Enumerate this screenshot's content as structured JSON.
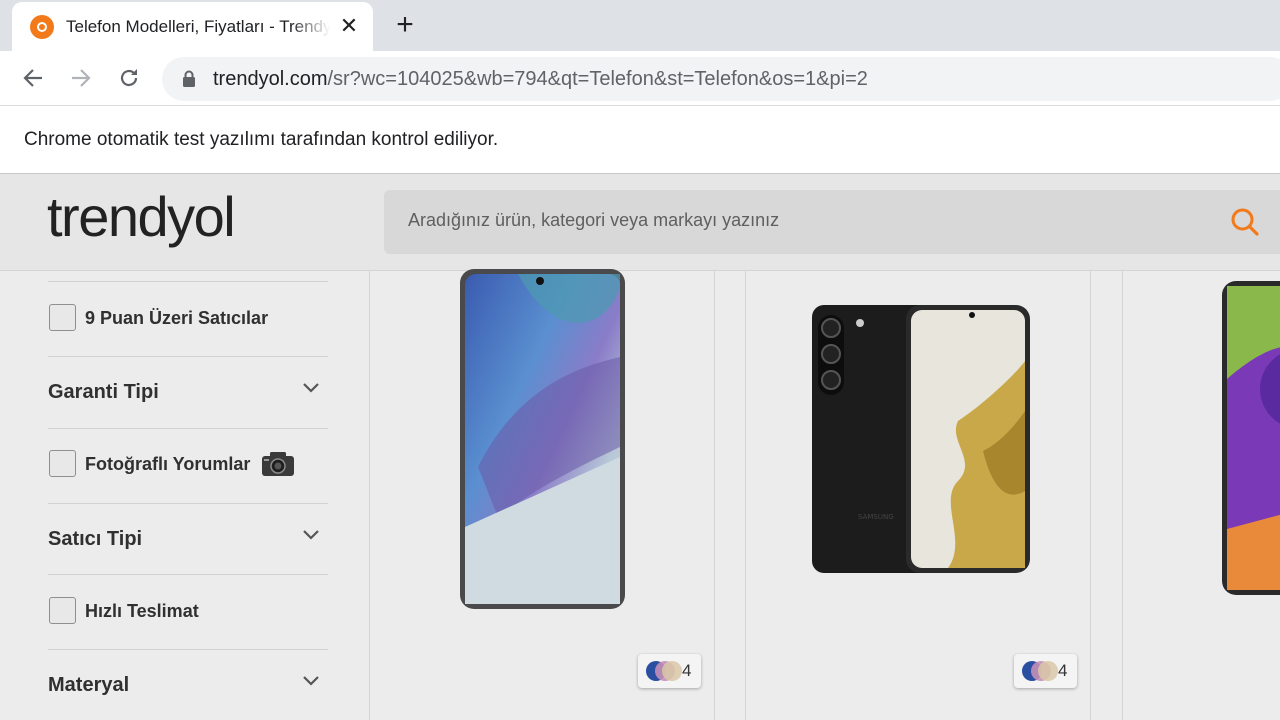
{
  "browser": {
    "tab_title": "Telefon Modelleri, Fiyatları - Trendyol",
    "close_glyph": "✕",
    "new_tab_glyph": "+",
    "url_host": "trendyol.com",
    "url_path": "/sr?wc=104025&wb=794&qt=Telefon&st=Telefon&os=1&pi=2",
    "infobar_text": "Chrome otomatik test yazılımı tarafından kontrol ediliyor."
  },
  "site": {
    "logo": "trendyol",
    "search_placeholder": "Aradığınız ürün, kategori veya markayı yazınız",
    "accent_color": "#f27a1a"
  },
  "filters": {
    "seller_score": "9 Puan Üzeri Satıcılar",
    "warranty_type": "Garanti Tipi",
    "photo_reviews": "Fotoğraflı Yorumlar",
    "seller_type": "Satıcı Tipi",
    "fast_delivery": "Hızlı Teslimat",
    "material": "Materyal"
  },
  "products": [
    {
      "color_count": "4"
    },
    {
      "color_count": "4",
      "brand_print": "SAMSUNG"
    }
  ]
}
